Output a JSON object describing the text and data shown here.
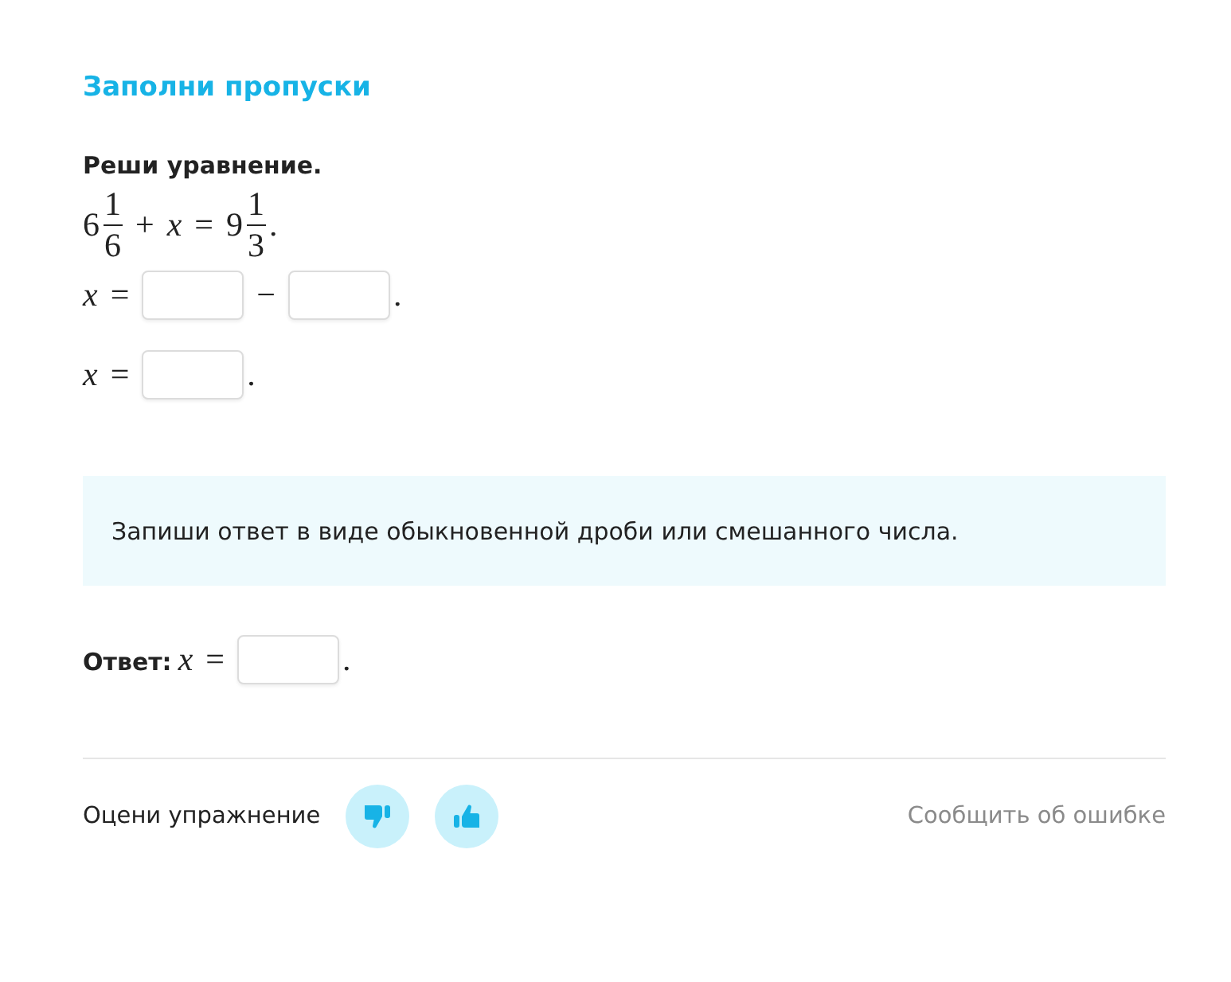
{
  "heading": "Заполни пропуски",
  "task": "Реши уравнение.",
  "lines": [
    {
      "tokens": [
        {
          "kind": "mixed",
          "whole": "6",
          "num": "1",
          "den": "6"
        },
        {
          "kind": "op",
          "text": "+"
        },
        {
          "kind": "var",
          "text": "x"
        },
        {
          "kind": "op",
          "text": "="
        },
        {
          "kind": "mixed",
          "whole": "9",
          "num": "1",
          "den": "3"
        },
        {
          "kind": "punct",
          "text": "."
        }
      ]
    },
    {
      "tokens": [
        {
          "kind": "var",
          "text": "x"
        },
        {
          "kind": "op",
          "text": "="
        },
        {
          "kind": "field"
        },
        {
          "kind": "op",
          "text": "−"
        },
        {
          "kind": "field"
        },
        {
          "kind": "punct",
          "text": "."
        }
      ]
    },
    {
      "tokens": [
        {
          "kind": "var",
          "text": "x"
        },
        {
          "kind": "op",
          "text": "="
        },
        {
          "kind": "field"
        },
        {
          "kind": "punct",
          "text": "."
        }
      ]
    }
  ],
  "hint": "Запиши ответ в виде обыкновенной дроби или смешанного числа.",
  "answer": {
    "label": "Ответ:",
    "tokens": [
      {
        "kind": "var",
        "text": "x"
      },
      {
        "kind": "op",
        "text": "="
      },
      {
        "kind": "field"
      },
      {
        "kind": "punct",
        "text": "."
      }
    ]
  },
  "footer": {
    "rate_label": "Оцени упражнение",
    "report_link": "Сообщить об ошибке"
  }
}
